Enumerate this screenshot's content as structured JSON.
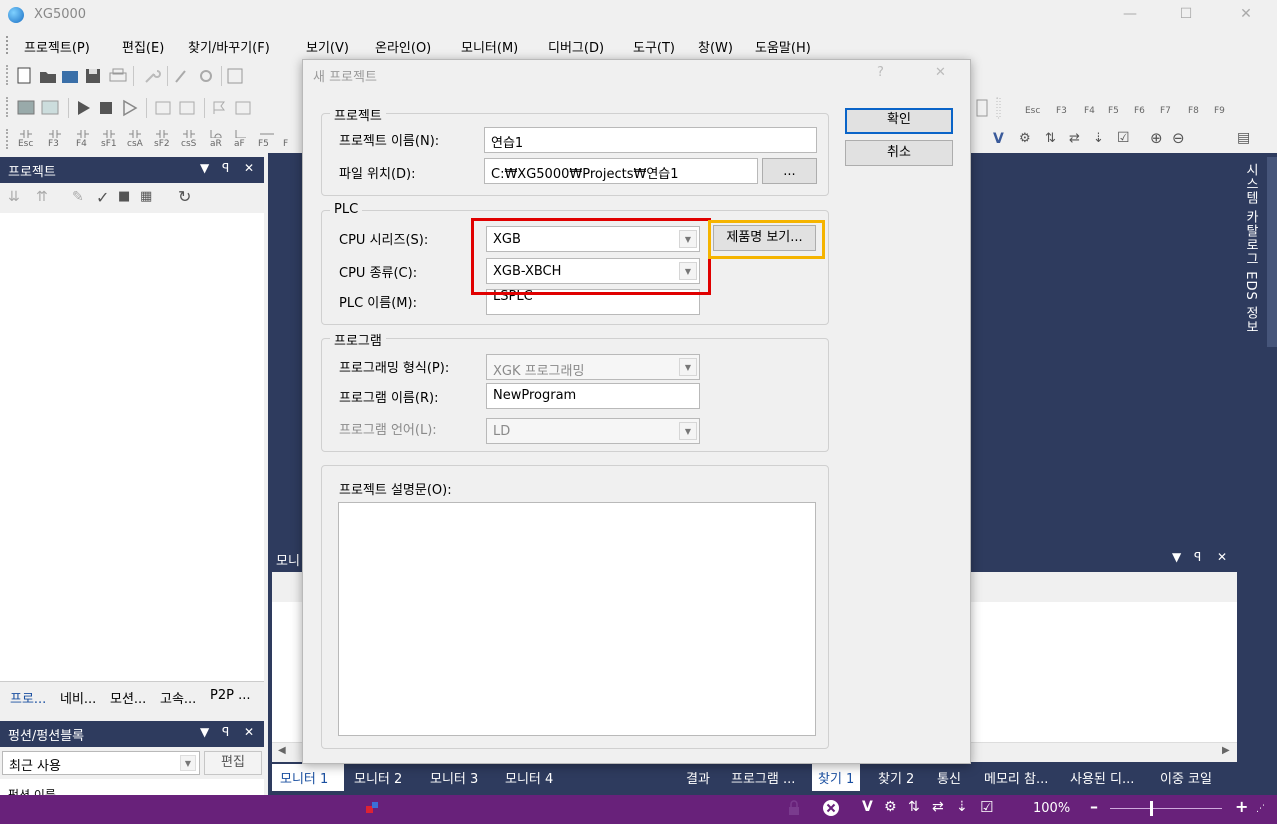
{
  "app": {
    "title": "XG5000"
  },
  "menu": [
    "프로젝트(P)",
    "편집(E)",
    "찾기/바꾸기(F)",
    "보기(V)",
    "온라인(O)",
    "모니터(M)",
    "디버그(D)",
    "도구(T)",
    "창(W)",
    "도움말(H)"
  ],
  "toolbar": {
    "fkeys_left": [
      "Esc",
      "F3",
      "F4",
      "sF1",
      "csA",
      "sF2",
      "csS",
      "aR",
      "aF",
      "F5",
      "F"
    ],
    "fkeys_right": [
      "Esc",
      "F3",
      "F4",
      "F5",
      "F6",
      "F7",
      "F8",
      "F9"
    ]
  },
  "project_panel": {
    "title": "프로젝트"
  },
  "left_tabs": [
    "프로...",
    "네비...",
    "모션...",
    "고속...",
    "P2P ..."
  ],
  "function_panel": {
    "title": "펑션/펑션블록",
    "filter": "최근 사용",
    "edit_label": "편집",
    "list_first": "펑션 이름"
  },
  "right_sidebar": {
    "label": "시스템 카탈로그 EDS 정보"
  },
  "monitor_panel": {
    "title_fragment": "모니"
  },
  "bottom_tabs_left": [
    "모니터 1",
    "모니터 2",
    "모니터 3",
    "모니터 4"
  ],
  "bottom_tabs_right": [
    "결과",
    "프로그램 ...",
    "찾기 1",
    "찾기 2",
    "통신",
    "메모리 참...",
    "사용된 디...",
    "이중 코일"
  ],
  "dialog": {
    "title": "새 프로젝트",
    "ok": "확인",
    "cancel": "취소",
    "project_group": "프로젝트",
    "project_name_label": "프로젝트 이름(N):",
    "project_name_value": "연습1",
    "file_location_label": "파일 위치(D):",
    "file_location_value": "C:₩XG5000₩Projects₩연습1",
    "browse": "...",
    "plc_group": "PLC",
    "cpu_series_label": "CPU 시리즈(S):",
    "cpu_series_value": "XGB",
    "product_name_button": "제품명 보기...",
    "cpu_type_label": "CPU 종류(C):",
    "cpu_type_value": "XGB-XBCH",
    "plc_name_label": "PLC 이름(M):",
    "plc_name_value": "LSPLC",
    "program_group": "프로그램",
    "programming_type_label": "프로그래밍 형식(P):",
    "programming_type_value": "XGK 프로그래밍",
    "program_name_label": "프로그램 이름(R):",
    "program_name_value": "NewProgram",
    "program_language_label": "프로그램 언어(L):",
    "program_language_value": "LD",
    "description_label": "프로젝트 설명문(O):",
    "help": "?",
    "close": "✕"
  },
  "statusbar": {
    "zoom": "100%"
  },
  "colors": {
    "dark_panel": "#2e3b5e",
    "status_bar": "#68217a",
    "highlight_red": "#e00000",
    "highlight_orange": "#f5b400"
  }
}
